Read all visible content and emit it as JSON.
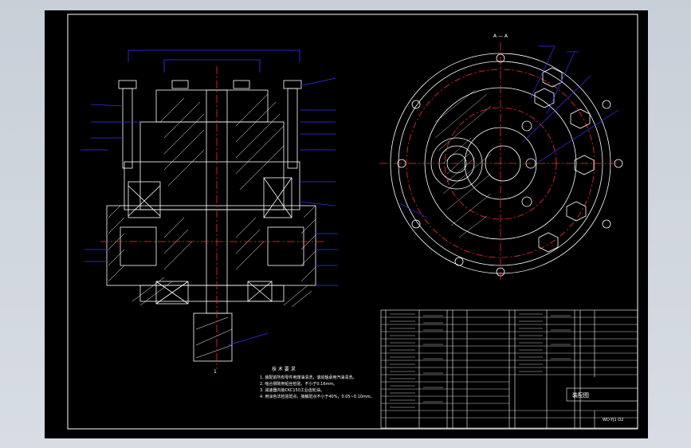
{
  "section_label": "A — A",
  "assembly_title": "装配图",
  "drawing_number": "WD-YJ1 D2",
  "notes_title": "技 术 要 求",
  "notes": [
    "1. 装配前所有零件用煤油清洗，滚动轴承用汽油清洗。",
    "2. 啮合侧隙用铅丝检验，不小于0.16mm。",
    "3. 减速器内装CKC150工业齿轮油。",
    "4. 用涂色法检验斑点，接触斑点不小于40%，0.05~0.10mm。"
  ],
  "center_mark": "1",
  "colors": {
    "frame": "#ffffff",
    "section": "#ffffff",
    "centerline": "#ff2a2a",
    "leader": "#2a2aff",
    "hatch": "#ffffff"
  }
}
